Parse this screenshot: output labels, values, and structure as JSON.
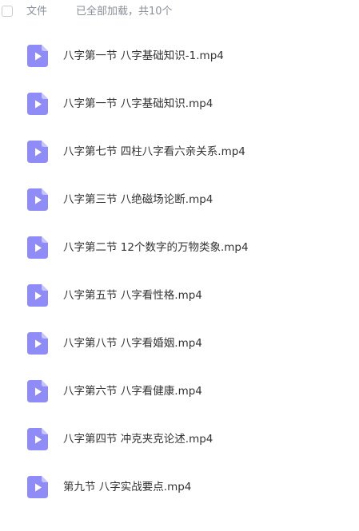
{
  "header": {
    "file_label": "文件",
    "status": "已全部加载，共10个"
  },
  "files": [
    {
      "name": "八字第一节 八字基础知识-1.mp4",
      "icon": "video-file-icon"
    },
    {
      "name": "八字第一节 八字基础知识.mp4",
      "icon": "video-file-icon"
    },
    {
      "name": "八字第七节 四柱八字看六亲关系.mp4",
      "icon": "video-file-icon"
    },
    {
      "name": "八字第三节 八绝磁场论断.mp4",
      "icon": "video-file-icon"
    },
    {
      "name": "八字第二节 12个数字的万物类象.mp4",
      "icon": "video-file-icon"
    },
    {
      "name": "八字第五节 八字看性格.mp4",
      "icon": "video-file-icon"
    },
    {
      "name": "八字第八节 八字看婚姻.mp4",
      "icon": "video-file-icon"
    },
    {
      "name": "八字第六节 八字看健康.mp4",
      "icon": "video-file-icon"
    },
    {
      "name": "八字第四节 冲克夹克论述.mp4",
      "icon": "video-file-icon"
    },
    {
      "name": "第九节 八字实战要点.mp4",
      "icon": "video-file-icon"
    }
  ],
  "colors": {
    "icon_fill": "#8f8cf8",
    "icon_fold": "#c7c5fc",
    "header_text": "#8a8f99",
    "file_text": "#333333"
  }
}
